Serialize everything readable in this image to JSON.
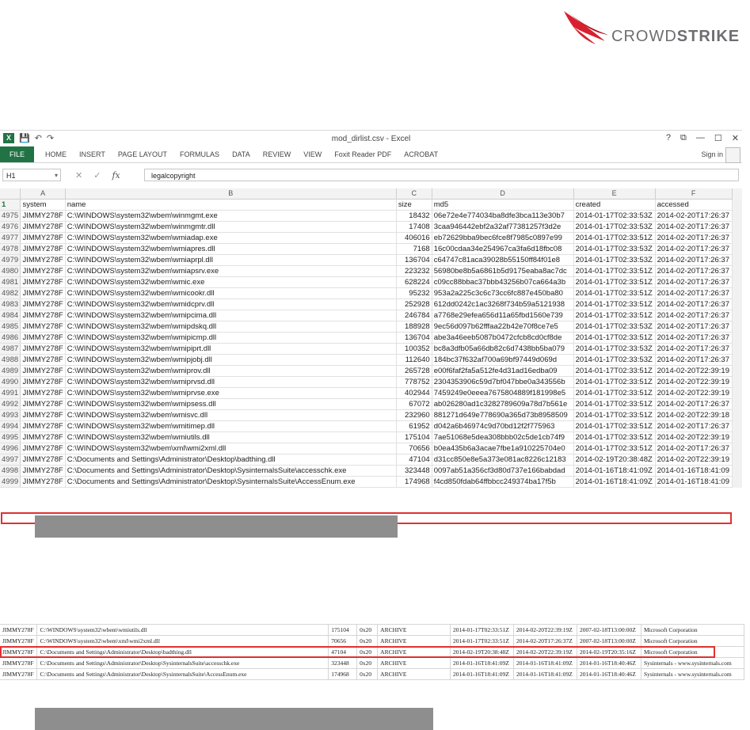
{
  "logo": {
    "text_crowd": "CROWD",
    "text_strike": "STRIKE",
    "brand_color": "#d8202f"
  },
  "excel": {
    "title": "mod_dirlist.csv - Excel",
    "qat_icons": [
      "excel-icon",
      "save-icon",
      "undo-icon",
      "redo-icon"
    ],
    "window_controls": [
      "?",
      "⧉",
      "—",
      "☐",
      "✕"
    ],
    "ribbon_tabs": [
      "FILE",
      "HOME",
      "INSERT",
      "PAGE LAYOUT",
      "FORMULAS",
      "DATA",
      "REVIEW",
      "VIEW",
      "Foxit Reader PDF",
      "ACROBAT"
    ],
    "sign_in": "Sign in",
    "name_box": "H1",
    "formula": "legalcopyright",
    "column_letters": [
      "A",
      "B",
      "C",
      "D",
      "E",
      "F"
    ],
    "header_row": {
      "row": "1",
      "system": "system",
      "name": "name",
      "size": "size",
      "md5": "md5",
      "created": "created",
      "accessed": "accessed"
    },
    "rows": [
      {
        "row": "4975",
        "system": "JIMMY278F",
        "name": "C:\\WINDOWS\\system32\\wbem\\winmgmt.exe",
        "size": "18432",
        "md5": "06e72e4e774034ba8dfe3bca113e30b7",
        "created": "2014-01-17T02:33:53Z",
        "accessed": "2014-02-20T17:26:37"
      },
      {
        "row": "4976",
        "system": "JIMMY278F",
        "name": "C:\\WINDOWS\\system32\\wbem\\winmgmtr.dll",
        "size": "17408",
        "md5": "3caa946442ebf2a32af77381257f3d2e",
        "created": "2014-01-17T02:33:53Z",
        "accessed": "2014-02-20T17:26:37"
      },
      {
        "row": "4977",
        "system": "JIMMY278F",
        "name": "C:\\WINDOWS\\system32\\wbem\\wmiadap.exe",
        "size": "406016",
        "md5": "eb72629bba9bec6fce8f7985c0897e99",
        "created": "2014-01-17T02:33:51Z",
        "accessed": "2014-02-20T17:26:37"
      },
      {
        "row": "4978",
        "system": "JIMMY278F",
        "name": "C:\\WINDOWS\\system32\\wbem\\wmiapres.dll",
        "size": "7168",
        "md5": "16c00cdaa34e254967ca3fa6d18fbc08",
        "created": "2014-01-17T02:33:53Z",
        "accessed": "2014-02-20T17:26:37"
      },
      {
        "row": "4979",
        "system": "JIMMY278F",
        "name": "C:\\WINDOWS\\system32\\wbem\\wmiaprpl.dll",
        "size": "136704",
        "md5": "c64747c81aca39028b55150ff84f01e8",
        "created": "2014-01-17T02:33:53Z",
        "accessed": "2014-02-20T17:26:37"
      },
      {
        "row": "4980",
        "system": "JIMMY278F",
        "name": "C:\\WINDOWS\\system32\\wbem\\wmiapsrv.exe",
        "size": "223232",
        "md5": "56980be8b5a6861b5d9175eaba8ac7dc",
        "created": "2014-01-17T02:33:51Z",
        "accessed": "2014-02-20T17:26:37"
      },
      {
        "row": "4981",
        "system": "JIMMY278F",
        "name": "C:\\WINDOWS\\system32\\wbem\\wmic.exe",
        "size": "628224",
        "md5": "c09cc88bbac37bbb43256b07ca664a3b",
        "created": "2014-01-17T02:33:51Z",
        "accessed": "2014-02-20T17:26:37"
      },
      {
        "row": "4982",
        "system": "JIMMY278F",
        "name": "C:\\WINDOWS\\system32\\wbem\\wmicookr.dll",
        "size": "95232",
        "md5": "953a2a225c3c6c73cc6fc887e450ba80",
        "created": "2014-01-17T02:33:51Z",
        "accessed": "2014-02-20T17:26:37"
      },
      {
        "row": "4983",
        "system": "JIMMY278F",
        "name": "C:\\WINDOWS\\system32\\wbem\\wmidcprv.dll",
        "size": "252928",
        "md5": "612dd0242c1ac3268f734b59a5121938",
        "created": "2014-01-17T02:33:51Z",
        "accessed": "2014-02-20T17:26:37"
      },
      {
        "row": "4984",
        "system": "JIMMY278F",
        "name": "C:\\WINDOWS\\system32\\wbem\\wmipcima.dll",
        "size": "246784",
        "md5": "a7768e29efea656d11a65fbd1560e739",
        "created": "2014-01-17T02:33:51Z",
        "accessed": "2014-02-20T17:26:37"
      },
      {
        "row": "4985",
        "system": "JIMMY278F",
        "name": "C:\\WINDOWS\\system32\\wbem\\wmipdskq.dll",
        "size": "188928",
        "md5": "9ec56d097b62fffaa22b42e70f8ce7e5",
        "created": "2014-01-17T02:33:53Z",
        "accessed": "2014-02-20T17:26:37"
      },
      {
        "row": "4986",
        "system": "JIMMY278F",
        "name": "C:\\WINDOWS\\system32\\wbem\\wmipicmp.dll",
        "size": "136704",
        "md5": "abe3a46eeb5087b0472cfcb8cd0cf8de",
        "created": "2014-01-17T02:33:51Z",
        "accessed": "2014-02-20T17:26:37"
      },
      {
        "row": "4987",
        "system": "JIMMY278F",
        "name": "C:\\WINDOWS\\system32\\wbem\\wmipiprt.dll",
        "size": "100352",
        "md5": "bc8a3dfb05a66db82c6d7438bb5ba079",
        "created": "2014-01-17T02:33:53Z",
        "accessed": "2014-02-20T17:26:37"
      },
      {
        "row": "4988",
        "system": "JIMMY278F",
        "name": "C:\\WINDOWS\\system32\\wbem\\wmipjobj.dll",
        "size": "112640",
        "md5": "184bc37f632af700a69bf97449d069d",
        "created": "2014-01-17T02:33:53Z",
        "accessed": "2014-02-20T17:26:37"
      },
      {
        "row": "4989",
        "system": "JIMMY278F",
        "name": "C:\\WINDOWS\\system32\\wbem\\wmiprov.dll",
        "size": "265728",
        "md5": "e00f6faf2fa5a512fe4d31ad16edba09",
        "created": "2014-01-17T02:33:51Z",
        "accessed": "2014-02-20T22:39:19"
      },
      {
        "row": "4990",
        "system": "JIMMY278F",
        "name": "C:\\WINDOWS\\system32\\wbem\\wmiprvsd.dll",
        "size": "778752",
        "md5": "2304353906c59d7bf047bbe0a343556b",
        "created": "2014-01-17T02:33:51Z",
        "accessed": "2014-02-20T22:39:19"
      },
      {
        "row": "4991",
        "system": "JIMMY278F",
        "name": "C:\\WINDOWS\\system32\\wbem\\wmiprvse.exe",
        "size": "402944",
        "md5": "7459249e0eeea7675804889f181998e5",
        "created": "2014-01-17T02:33:51Z",
        "accessed": "2014-02-20T22:39:19"
      },
      {
        "row": "4992",
        "system": "JIMMY278F",
        "name": "C:\\WINDOWS\\system32\\wbem\\wmipsess.dll",
        "size": "67072",
        "md5": "ab026280ad1c3282789609a78d7b561e",
        "created": "2014-01-17T02:33:51Z",
        "accessed": "2014-02-20T17:26:37"
      },
      {
        "row": "4993",
        "system": "JIMMY278F",
        "name": "C:\\WINDOWS\\system32\\wbem\\wmisvc.dll",
        "size": "232960",
        "md5": "881271d649e778690a365d73b8958509",
        "created": "2014-01-17T02:33:51Z",
        "accessed": "2014-02-20T22:39:18"
      },
      {
        "row": "4994",
        "system": "JIMMY278F",
        "name": "C:\\WINDOWS\\system32\\wbem\\wmitimep.dll",
        "size": "61952",
        "md5": "d042a6b46974c9d70bd12f2f775963",
        "created": "2014-01-17T02:33:51Z",
        "accessed": "2014-02-20T17:26:37"
      },
      {
        "row": "4995",
        "system": "JIMMY278F",
        "name": "C:\\WINDOWS\\system32\\wbem\\wmiutils.dll",
        "size": "175104",
        "md5": "7ae51068e5dea308bbb02c5de1cb74f9",
        "created": "2014-01-17T02:33:51Z",
        "accessed": "2014-02-20T22:39:19"
      },
      {
        "row": "4996",
        "system": "JIMMY278F",
        "name": "C:\\WINDOWS\\system32\\wbem\\xml\\wmi2xml.dll",
        "size": "70656",
        "md5": "b0ea435b6a3acae7fbe1a910225704e0",
        "created": "2014-01-17T02:33:51Z",
        "accessed": "2014-02-20T17:26:37"
      },
      {
        "row": "4997",
        "system": "JIMMY278F",
        "name": "C:\\Documents and Settings\\Administrator\\Desktop\\badthing.dll",
        "size": "47104",
        "md5": "d31cc850e8e5a373e081ac8226c12183",
        "created": "2014-02-19T20:38:48Z",
        "accessed": "2014-02-20T22:39:19"
      },
      {
        "row": "4998",
        "system": "JIMMY278F",
        "name": "C:\\Documents and Settings\\Administrator\\Desktop\\SysinternalsSuite\\accesschk.exe",
        "size": "323448",
        "md5": "0097ab51a356cf3d80d737e166babdad",
        "created": "2014-01-16T18:41:09Z",
        "accessed": "2014-01-16T18:41:09"
      },
      {
        "row": "4999",
        "system": "JIMMY278F",
        "name": "C:\\Documents and Settings\\Administrator\\Desktop\\SysinternalsSuite\\AccessEnum.exe",
        "size": "174968",
        "md5": "f4cd850fdab64ffbbcc249374ba17f5b",
        "created": "2014-01-16T18:41:09Z",
        "accessed": "2014-01-16T18:41:09"
      }
    ]
  },
  "listing2": {
    "rows": [
      {
        "system": "JIMMY278F",
        "path": "C:\\WINDOWS\\system32\\wbem\\wmiutils.dll",
        "size": "175104",
        "attr": "0x20",
        "type": "ARCHIVE",
        "created": "2014-01-17T02:33:51Z",
        "accessed": "2014-02-20T22:39:19Z",
        "modified": "2007-02-18T13:00:00Z",
        "company": "Microsoft Corporation"
      },
      {
        "system": "JIMMY278F",
        "path": "C:\\WINDOWS\\system32\\wbem\\xml\\wmi2xml.dll",
        "size": "70656",
        "attr": "0x20",
        "type": "ARCHIVE",
        "created": "2014-01-17T02:33:51Z",
        "accessed": "2014-02-20T17:26:37Z",
        "modified": "2007-02-18T13:00:00Z",
        "company": "Microsoft Corporation"
      },
      {
        "system": "JIMMY278F",
        "path": "C:\\Documents and Settings\\Administrator\\Desktop\\badthing.dll",
        "size": "47104",
        "attr": "0x20",
        "type": "ARCHIVE",
        "created": "2014-02-19T20:38:48Z",
        "accessed": "2014-02-20T22:39:19Z",
        "modified": "2014-02-19T20:35:16Z",
        "company": "Microsoft Corporation"
      },
      {
        "system": "JIMMY278F",
        "path": "C:\\Documents and Settings\\Administrator\\Desktop\\SysinternalsSuite\\accesschk.exe",
        "size": "323448",
        "attr": "0x20",
        "type": "ARCHIVE",
        "created": "2014-01-16T18:41:09Z",
        "accessed": "2014-01-16T18:41:09Z",
        "modified": "2014-01-16T18:40:46Z",
        "company": "Sysinternals - www.sysinternals.com"
      },
      {
        "system": "JIMMY278F",
        "path": "C:\\Documents and Settings\\Administrator\\Desktop\\SysinternalsSuite\\AccessEnum.exe",
        "size": "174968",
        "attr": "0x20",
        "type": "ARCHIVE",
        "created": "2014-01-16T18:41:09Z",
        "accessed": "2014-01-16T18:41:09Z",
        "modified": "2014-01-16T18:40:46Z",
        "company": "Sysinternals - www.sysinternals.com"
      }
    ]
  }
}
